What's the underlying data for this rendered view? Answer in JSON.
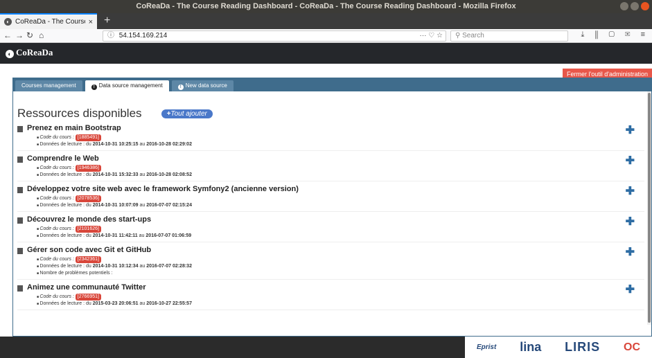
{
  "window": {
    "title": "CoReaDa - The Course Reading Dashboard - CoReaDa - The Course Reading Dashboard - Mozilla Firefox"
  },
  "browser": {
    "tab_title": "CoReaDa - The Course Re",
    "url": "54.154.169.214",
    "search_placeholder": "Search",
    "url_actions": "··· ♡ ☆"
  },
  "app": {
    "name": "CoReaDa"
  },
  "admin": {
    "close_button": "Fermer l'outil d'administration"
  },
  "tabs": [
    {
      "label": "Courses management"
    },
    {
      "label": "Data source management"
    },
    {
      "label": "New data source"
    }
  ],
  "section": {
    "title": "Ressources disponibles",
    "add_all": "Tout ajouter"
  },
  "labels": {
    "code": "Code du cours :",
    "reading": "Données de lecture : du",
    "to": "au",
    "problems": "Nombre de problèmes potentiels :"
  },
  "courses": [
    {
      "title": "Prenez en main Bootstrap",
      "code": "[1885491]",
      "from": "2014-10-31 10:25:15",
      "to": "2016-10-28 02:29:02"
    },
    {
      "title": "Comprendre le Web",
      "code": "[1946386]",
      "from": "2014-10-31 15:32:33",
      "to": "2016-10-28 02:08:52"
    },
    {
      "title": "Développez votre site web avec le framework Symfony2 (ancienne version)",
      "code": "[2078536]",
      "from": "2014-10-31 10:07:09",
      "to": "2016-07-07 02:15:24"
    },
    {
      "title": "Découvrez le monde des start-ups",
      "code": "[2101626]",
      "from": "2014-10-31 11:42:11",
      "to": "2016-07-07 01:06:59"
    },
    {
      "title": "Gérer son code avec Git et GitHub",
      "code": "[2342361]",
      "from": "2014-10-31 10:12:34",
      "to": "2016-07-07 02:28:32"
    },
    {
      "title": "Animez une communauté Twitter",
      "code": "[2766951]",
      "from": "2015-03-23 20:06:51",
      "to": "2016-10-27 22:55:57"
    }
  ],
  "footer": {
    "logo1": "Eprist",
    "logo2": "lina",
    "logo3": "LIRIS",
    "logo4": "OC"
  }
}
